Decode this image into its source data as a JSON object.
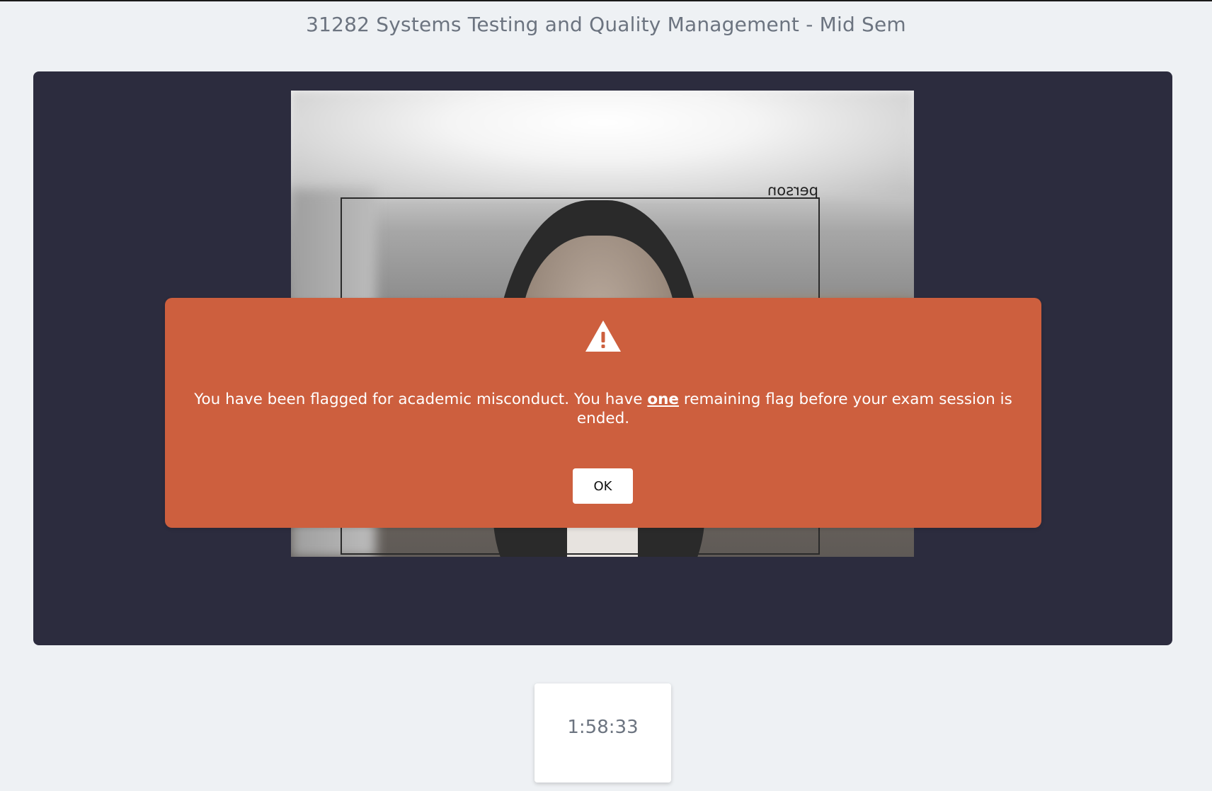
{
  "header": {
    "title": "31282 Systems Testing and Quality Management - Mid Sem"
  },
  "webcam": {
    "detection_label": "person"
  },
  "alert": {
    "icon": "warning-triangle-icon",
    "message_part1": "You have been flagged for academic misconduct. You have ",
    "message_emphasis": "one",
    "message_part2": " remaining flag before your exam session is ended.",
    "ok_label": "OK",
    "background_color": "#cd5f3e"
  },
  "timer": {
    "remaining": "1:58:33"
  }
}
